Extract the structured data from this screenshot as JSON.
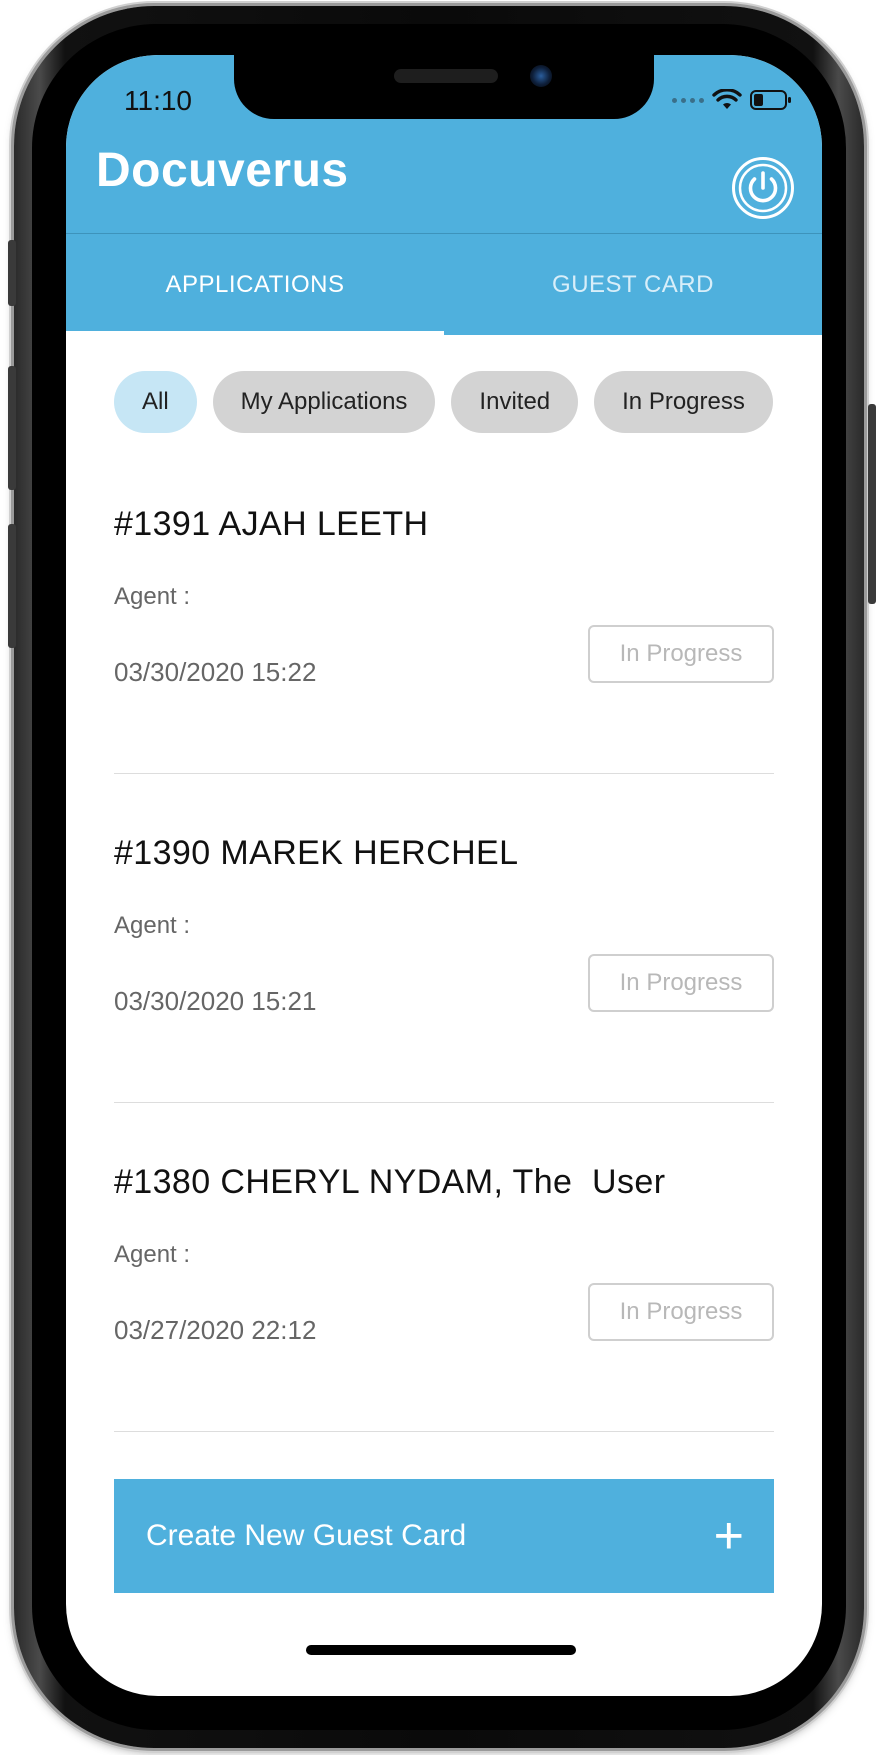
{
  "status_bar": {
    "time": "11:10"
  },
  "header": {
    "title": "Docuverus",
    "power_icon": "power-icon"
  },
  "tabs": [
    {
      "label": "APPLICATIONS",
      "active": true
    },
    {
      "label": "GUEST CARD",
      "active": false
    }
  ],
  "filters": [
    {
      "label": "All",
      "selected": true
    },
    {
      "label": "My Applications",
      "selected": false
    },
    {
      "label": "Invited",
      "selected": false
    },
    {
      "label": "In Progress",
      "selected": false
    }
  ],
  "applications": [
    {
      "title": "#1391 AJAH LEETH",
      "agent_label": "Agent :",
      "date": "03/30/2020 15:22",
      "status": "In Progress"
    },
    {
      "title": "#1390 MAREK HERCHEL",
      "agent_label": "Agent :",
      "date": "03/30/2020 15:21",
      "status": "In Progress"
    },
    {
      "title": "#1380 CHERYL NYDAM, The  User",
      "agent_label": "Agent :",
      "date": "03/27/2020 22:12",
      "status": "In Progress"
    }
  ],
  "create_button": {
    "label": "Create New Guest Card",
    "icon": "+"
  },
  "colors": {
    "brand": "#4fb0dd",
    "chip_selected": "#c6e6f5",
    "chip": "#d3d3d3"
  }
}
